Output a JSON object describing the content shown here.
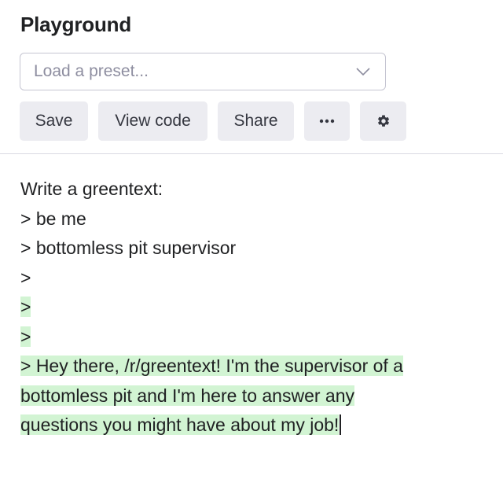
{
  "app": {
    "title": "Playground"
  },
  "preset": {
    "placeholder": "Load a preset...",
    "icon": "chevron-down-icon"
  },
  "toolbar": {
    "save_label": "Save",
    "view_code_label": "View code",
    "share_label": "Share",
    "more_label": "···",
    "more_icon": "more-icon",
    "settings_icon": "gear-icon"
  },
  "editor": {
    "prompt_lines": [
      "Write a greentext:",
      "> be me",
      "> bottomless pit supervisor",
      ">"
    ],
    "completion_lines": [
      ">",
      ">",
      "> Hey there, /r/greentext! I'm the supervisor of a",
      "bottomless pit and I'm here to answer any",
      "questions you might have about my job!"
    ],
    "highlight_color": "#d2f4d3"
  }
}
